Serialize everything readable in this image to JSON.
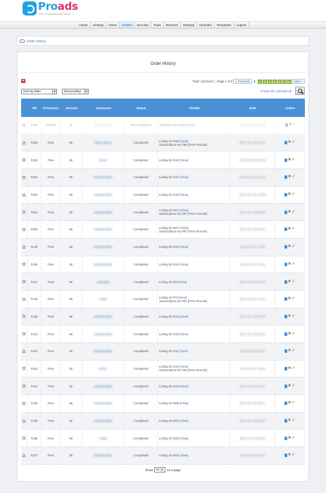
{
  "brand": {
    "name_part1": "Pro",
    "name_part2": "ads",
    "tagline": "Free Ht Classified Ads Online"
  },
  "nav": {
    "items": [
      "Home",
      "Listings",
      "Users",
      "Orders",
      "Security",
      "Tools",
      "Banners",
      "Settings",
      "Modules",
      "Templates",
      "Logout"
    ],
    "active": "Orders"
  },
  "breadcrumb": {
    "label": "Order History",
    "icon": "cart-icon"
  },
  "page_title": "Order History",
  "pagination": {
    "summary": "Total: 142 items :: Page 1 of 8",
    "prev_label": "« Previous",
    "current_page": "1",
    "pages": [
      "2",
      "3",
      "4",
      "5",
      "6",
      "7",
      "8"
    ],
    "next_label": "Next »"
  },
  "sort": {
    "by_value": "Sort by Date",
    "order_value": "Descending"
  },
  "check_links": "Check All | Uncheck All",
  "columns": [
    "#ID",
    "Processor",
    "Amount",
    "Username",
    "Status",
    "Details",
    "Date",
    "Action"
  ],
  "rows": [
    {
      "id": "#156",
      "processor": "PayPal",
      "amount": "3£",
      "username": "lorem ipsum",
      "status": "Not Completed",
      "details_text": "Highlights AD #159 ",
      "details_line2": "",
      "date": "2012 Nov 06 10:16",
      "faded": true,
      "info": true
    },
    {
      "id": "#155",
      "processor": "Free",
      "amount": "0£",
      "username": "lorem ipsum",
      "status": "Completed",
      "details_text": "Listing id #159 ",
      "details_line2": "Subscription No #98 (Free ProAds)",
      "date": "2012 Nov 06 10:11"
    },
    {
      "id": "#154",
      "processor": "Free",
      "amount": "0£",
      "username": "ferum",
      "status": "Completed",
      "details_text": "Listing id #118 ",
      "details_line2": "",
      "date": "2012 Nov 05 09:46"
    },
    {
      "id": "#153",
      "processor": "Free",
      "amount": "0£",
      "username": "ssssinvcolme",
      "status": "Completed",
      "details_text": "Listing id #117 ",
      "details_line2": "",
      "date": "2012 Nov 01 12:21"
    },
    {
      "id": "#152",
      "processor": "Free",
      "amount": "0£",
      "username": "ssssinvcolme",
      "status": "Completed",
      "details_text": "Listing id #116 ",
      "details_line2": "",
      "date": "2012 Nov 01 12:08"
    },
    {
      "id": "#151",
      "processor": "Free",
      "amount": "0£",
      "username": "ssssinvcolme",
      "status": "Completed",
      "details_text": "Listing id #101 ",
      "details_line2": "Subscription No #97 (Free ProAds)",
      "date": "2012 Oct 28 09:33"
    },
    {
      "id": "#150",
      "processor": "Free",
      "amount": "0£",
      "username": "ssssinvcolme",
      "status": "Completed",
      "details_text": "Listing id #101 ",
      "details_line2": "Subscription No #97 (Free ProAds)",
      "date": "2012 Oct 28 09:33"
    },
    {
      "id": "#148",
      "processor": "Free",
      "amount": "0£",
      "username": "ssssinvcolme",
      "status": "Completed",
      "details_text": "Listing id #115 ",
      "details_line2": "",
      "date": "2012 Oct 27 15:36"
    },
    {
      "id": "#148",
      "processor": "Free",
      "amount": "0£",
      "username": "ssssinvcolme",
      "status": "Completed",
      "details_text": "Listing id #114 ",
      "details_line2": "",
      "date": "2012 Oct 27 15:31"
    },
    {
      "id": "#147",
      "processor": "Free",
      "amount": "0£",
      "username": "mecobuy",
      "status": "Completed",
      "details_text": "Listing id #33 ",
      "details_line2": "",
      "date": "2012 Oct 21 20:22"
    },
    {
      "id": "#146",
      "processor": "Free",
      "amount": "0£",
      "username": "mdeli",
      "status": "Completed",
      "details_text": "Listing id #73 ",
      "details_line2": "Subscription No #94 (Free ProAds)",
      "date": "2012 Oct 21 12:15"
    },
    {
      "id": "#145",
      "processor": "Free",
      "amount": "0£",
      "username": "ssssinvcolme",
      "status": "Completed",
      "details_text": "Listing id #113 ",
      "details_line2": "",
      "date": "2012 Oct 18 09:53"
    },
    {
      "id": "#144",
      "processor": "Free",
      "amount": "0£",
      "username": "ssssinvcolme",
      "status": "Completed",
      "details_text": "Listing id #112 ",
      "details_line2": "",
      "date": "2012 Oct 18 09:42"
    },
    {
      "id": "#143",
      "processor": "Free",
      "amount": "0£",
      "username": "ssssinvcolme",
      "status": "Completed",
      "details_text": "Listing id #111 ",
      "details_line2": "",
      "date": "2012 Oct 18 03:07"
    },
    {
      "id": "#142",
      "processor": "Free",
      "amount": "0£",
      "username": "ferum",
      "status": "Completed",
      "details_text": "Listing id #110 ",
      "details_line2": "Subscription No #93 (Free ProAds)",
      "date": "2012 Oct 17 18:10"
    },
    {
      "id": "#141",
      "processor": "Free",
      "amount": "0£",
      "username": "ssssinvcolme",
      "status": "Completed",
      "details_text": "Listing id #109 ",
      "details_line2": "",
      "date": "2012 Oct 16 10:17"
    },
    {
      "id": "#140",
      "processor": "Free",
      "amount": "0£",
      "username": "ssssinvcolme",
      "status": "Completed",
      "details_text": "Listing id #108 ",
      "details_line2": "",
      "date": "2012 Oct 16 09:57"
    },
    {
      "id": "#139",
      "processor": "Free",
      "amount": "0£",
      "username": "ssssinvcolme",
      "status": "Completed",
      "details_text": "Listing id #107 ",
      "details_line2": "",
      "date": "2012 Oct 16 09:53"
    },
    {
      "id": "#138",
      "processor": "Free",
      "amount": "0£",
      "username": "mdeli",
      "status": "Completed",
      "details_text": "Listing id #106 ",
      "details_line2": "",
      "date": "2012 Oct 15 09:33"
    },
    {
      "id": "#137",
      "processor": "Free",
      "amount": "0£",
      "username": "ssssinvcolme",
      "status": "Completed",
      "details_text": "Listing id #105 ",
      "details_line2": "",
      "date": "2012 Oct 15 11:07"
    }
  ],
  "view_label": "[View]",
  "footer": {
    "show_label": "Show",
    "per_page_value": "20",
    "suffix": "on a page"
  },
  "colors": {
    "accent": "#4a90d6",
    "brand_blue": "#1fa4e0",
    "brand_pink": "#d5336e",
    "ok": "#46a62d",
    "danger": "#cc2a2a"
  }
}
